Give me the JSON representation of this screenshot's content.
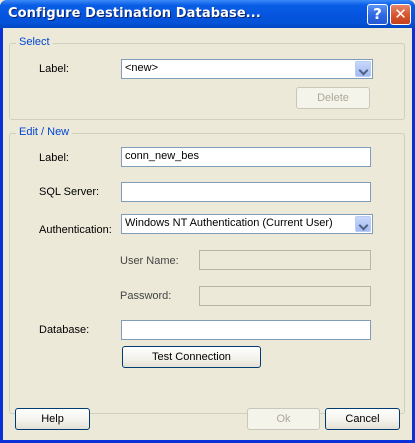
{
  "window": {
    "title": "Configure Destination Database...",
    "help_glyph": "?",
    "close_glyph": "✕"
  },
  "select_group": {
    "title": "Select",
    "label_text": "Label:",
    "label_value": "<new>",
    "delete_label": "Delete"
  },
  "edit_group": {
    "title": "Edit / New",
    "label_text": "Label:",
    "label_value": "conn_new_bes",
    "sql_server_text": "SQL Server:",
    "sql_server_value": "",
    "authentication_text": "Authentication:",
    "authentication_value": "Windows NT Authentication (Current User)",
    "user_name_text": "User Name:",
    "user_name_value": "",
    "password_text": "Password:",
    "password_value": "",
    "database_text": "Database:",
    "database_value": "",
    "test_connection_label": "Test Connection"
  },
  "footer": {
    "help_label": "Help",
    "ok_label": "Ok",
    "cancel_label": "Cancel"
  }
}
